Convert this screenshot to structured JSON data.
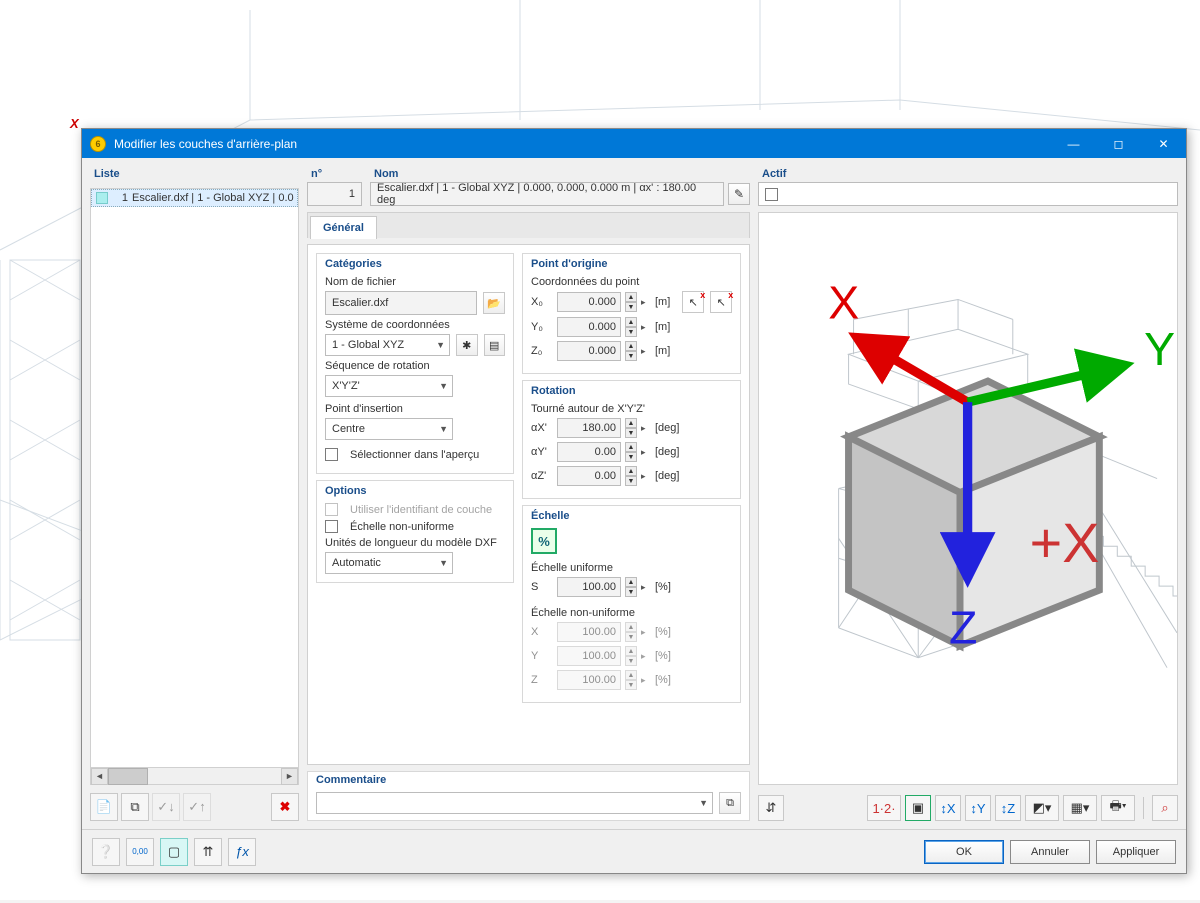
{
  "window": {
    "title": "Modifier les couches d'arrière-plan",
    "axis_x_label": "X"
  },
  "list": {
    "label": "Liste",
    "items": [
      {
        "num": "1",
        "text": "Escalier.dxf | 1 - Global XYZ | 0.0"
      }
    ],
    "toolbar": {
      "new": "✱",
      "copy": "⧉",
      "check1": "✓",
      "check2": "✓",
      "delete": "✖"
    }
  },
  "header": {
    "number_label": "n°",
    "number_value": "1",
    "name_label": "Nom",
    "name_value": "Escalier.dxf | 1 - Global XYZ | 0.000, 0.000, 0.000 m | αx' : 180.00 deg",
    "active_label": "Actif",
    "active_checked": false
  },
  "tabs": {
    "general": "Général"
  },
  "categories": {
    "title": "Catégories",
    "filename_label": "Nom de fichier",
    "filename_value": "Escalier.dxf",
    "cs_label": "Système de coordonnées",
    "cs_value": "1 - Global XYZ",
    "rotseq_label": "Séquence de rotation",
    "rotseq_value": "X'Y'Z'",
    "inspt_label": "Point d'insertion",
    "inspt_value": "Centre",
    "select_in_preview": "Sélectionner dans l'aperçu"
  },
  "options": {
    "title": "Options",
    "use_layer_id": "Utiliser l'identifiant de couche",
    "nonuniform_scale": "Échelle non-uniforme",
    "dxf_units_label": "Unités de longueur du modèle DXF",
    "dxf_units_value": "Automatic"
  },
  "origin": {
    "title": "Point d'origine",
    "coords_label": "Coordonnées du point",
    "x_label": "X₀",
    "x_value": "0.000",
    "y_label": "Y₀",
    "y_value": "0.000",
    "z_label": "Z₀",
    "z_value": "0.000",
    "unit": "[m]"
  },
  "rotation": {
    "title": "Rotation",
    "around_label": "Tourné autour de X'Y'Z'",
    "ax_label": "αX'",
    "ax_value": "180.00",
    "ay_label": "αY'",
    "ay_value": "0.00",
    "az_label": "αZ'",
    "az_value": "0.00",
    "unit": "[deg]"
  },
  "scale": {
    "title": "Échelle",
    "uniform_label": "Échelle uniforme",
    "s_label": "S",
    "s_value": "100.00",
    "nonuniform_label": "Échelle non-uniforme",
    "sx_label": "X",
    "sx_value": "100.00",
    "sy_label": "Y",
    "sy_value": "100.00",
    "sz_label": "Z",
    "sz_value": "100.00",
    "unit": "[%]"
  },
  "comment": {
    "label": "Commentaire",
    "value": ""
  },
  "axes3d": {
    "x": "X",
    "y": "Y",
    "z": "Z",
    "plusx": "+X"
  },
  "footer": {
    "ok": "OK",
    "cancel": "Annuler",
    "apply": "Appliquer"
  }
}
